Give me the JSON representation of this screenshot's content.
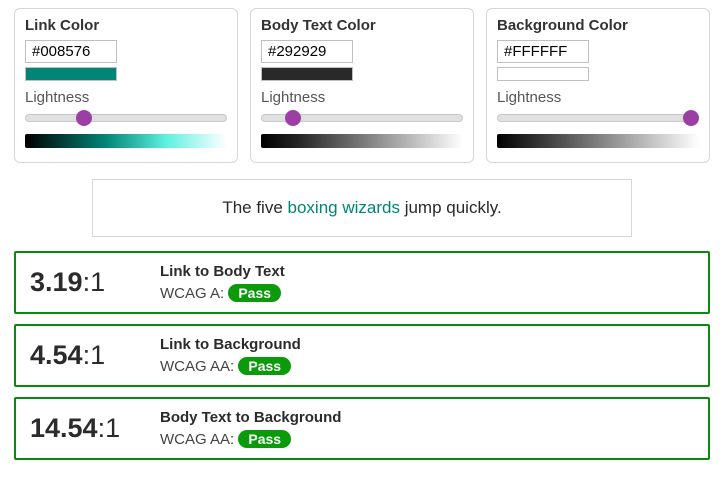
{
  "pickers": {
    "link": {
      "title": "Link Color",
      "value": "#008576",
      "lightness_label": "Lightness",
      "lightness_pct": 29,
      "gradient_css": "linear-gradient(to right, #000000, #008576 40%, #5ff1e1 70%, #ffffff)"
    },
    "body": {
      "title": "Body Text Color",
      "value": "#292929",
      "lightness_label": "Lightness",
      "lightness_pct": 16,
      "gradient_css": "linear-gradient(to right, #000000, #292929 20%, #ffffff)"
    },
    "bg": {
      "title": "Background Color",
      "value": "#FFFFFF",
      "lightness_label": "Lightness",
      "lightness_pct": 100,
      "gradient_css": "linear-gradient(to right, #000000, #ffffff)"
    }
  },
  "preview": {
    "before": "The five ",
    "link": "boxing wizards",
    "after": " jump quickly.",
    "link_color": "#008576",
    "body_color": "#292929",
    "bg_color": "#FFFFFF"
  },
  "results": [
    {
      "ratio": "3.19",
      "title": "Link to Body Text",
      "level": "WCAG A: ",
      "badge": "Pass"
    },
    {
      "ratio": "4.54",
      "title": "Link to Background",
      "level": "WCAG AA: ",
      "badge": "Pass"
    },
    {
      "ratio": "14.54",
      "title": "Body Text to Background",
      "level": "WCAG AA: ",
      "badge": "Pass"
    }
  ],
  "ratio_suffix": ":1"
}
